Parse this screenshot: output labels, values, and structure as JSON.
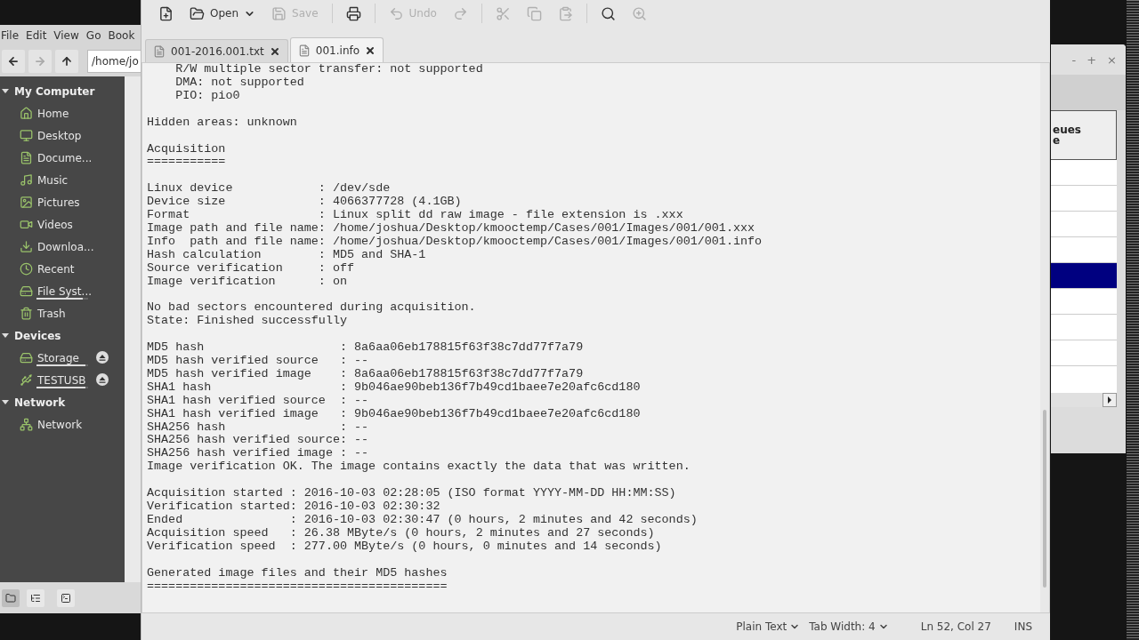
{
  "file_manager": {
    "menu": [
      "File",
      "Edit",
      "View",
      "Go",
      "Book"
    ],
    "nav": [
      {
        "kind": "back",
        "disabled": false
      },
      {
        "kind": "forward",
        "disabled": true
      },
      {
        "kind": "up",
        "disabled": false
      }
    ],
    "path": "/home/jo",
    "sections": [
      {
        "title": "My Computer",
        "expanded": true,
        "items": [
          {
            "label": "Home"
          },
          {
            "label": "Desktop"
          },
          {
            "label": "Docume..."
          },
          {
            "label": "Music"
          },
          {
            "label": "Pictures"
          },
          {
            "label": "Videos"
          },
          {
            "label": "Downloa..."
          },
          {
            "label": "Recent"
          },
          {
            "label": "File Syst...",
            "level": 0.9
          },
          {
            "label": "Trash"
          }
        ]
      },
      {
        "title": "Devices",
        "expanded": true,
        "items": [
          {
            "label": "Storage",
            "level": 0.95,
            "ejectable": true
          },
          {
            "label": "TESTUSB",
            "level": 0.95,
            "ejectable": true
          }
        ]
      },
      {
        "title": "Network",
        "expanded": true,
        "items": [
          {
            "label": "Network"
          }
        ]
      }
    ],
    "bottom_buttons": [
      {
        "kind": "places",
        "selected": true
      },
      {
        "kind": "tree",
        "selected": false
      },
      {
        "kind": "terminal",
        "selected": false
      }
    ]
  },
  "editor": {
    "toolbar": [
      {
        "kind": "new",
        "disabled": false
      },
      {
        "kind": "open",
        "label": "Open",
        "disabled": false
      },
      {
        "kind": "save",
        "label": "Save",
        "disabled": true
      },
      {
        "kind": "print",
        "disabled": false
      },
      {
        "kind": "undo",
        "label": "Undo",
        "disabled": true
      },
      {
        "kind": "redo",
        "disabled": true
      },
      {
        "kind": "cut",
        "disabled": true
      },
      {
        "kind": "copy",
        "disabled": true
      },
      {
        "kind": "paste",
        "disabled": true
      },
      {
        "kind": "find",
        "disabled": false
      },
      {
        "kind": "replace",
        "disabled": true
      }
    ],
    "tabs": [
      {
        "label": "001-2016.001.txt",
        "selected": false
      },
      {
        "label": "001.info",
        "selected": true
      }
    ],
    "blocks": [
      {
        "kind": "paragraph",
        "lines": [
          "    R/W multiple sector transfer: not supported",
          "    DMA: not supported",
          "    PIO: pio0"
        ]
      },
      {
        "kind": "paragraph",
        "lines": [
          "Hidden areas: unknown"
        ]
      },
      {
        "kind": "heading",
        "lines": [
          "Acquisition",
          "==========="
        ]
      },
      {
        "kind": "paragraph",
        "lines": [
          "Linux device            : /dev/sde",
          "Device size             : 4066377728 (4.1GB)",
          "Format                  : Linux split dd raw image - file extension is .xxx",
          "Image path and file name: /home/joshua/Desktop/kmooctemp/Cases/001/Images/001/001.xxx",
          "Info  path and file name: /home/joshua/Desktop/kmooctemp/Cases/001/Images/001/001.info",
          "Hash calculation        : MD5 and SHA-1",
          "Source verification     : off",
          "Image verification      : on"
        ]
      },
      {
        "kind": "paragraph",
        "lines": [
          "No bad sectors encountered during acquisition.",
          "State: Finished successfully"
        ]
      },
      {
        "kind": "paragraph",
        "lines": [
          "MD5 hash                   : 8a6aa06eb178815f63f38c7dd77f7a79",
          "MD5 hash verified source   : --",
          "MD5 hash verified image    : 8a6aa06eb178815f63f38c7dd77f7a79",
          "SHA1 hash                  : 9b046ae90beb136f7b49cd1baee7e20afc6cd180",
          "SHA1 hash verified source  : --",
          "SHA1 hash verified image   : 9b046ae90beb136f7b49cd1baee7e20afc6cd180",
          "SHA256 hash                : --",
          "SHA256 hash verified source: --",
          "SHA256 hash verified image : --",
          "Image verification OK. The image contains exactly the data that was written."
        ]
      },
      {
        "kind": "paragraph",
        "lines": [
          "Acquisition started : 2016-10-03 02:28:05 (ISO format YYYY-MM-DD HH:MM:SS)",
          "Verification started: 2016-10-03 02:30:32",
          "Ended               : 2016-10-03 02:30:47 (0 hours, 2 minutes and 42 seconds)",
          "Acquisition speed   : 26.38 MByte/s (0 hours, 2 minutes and 27 seconds)",
          "Verification speed  : 277.00 MByte/s (0 hours, 0 minutes and 14 seconds)"
        ]
      },
      {
        "kind": "heading",
        "lines": [
          "Generated image files and their MD5 hashes",
          "=========================================="
        ]
      }
    ],
    "status": {
      "syntax": "Plain Text",
      "tab_width": "Tab Width: 4",
      "position": "Ln 52, Col 27",
      "mode": "INS"
    }
  },
  "back_window": {
    "controls": [
      "-",
      "+",
      "×"
    ],
    "header_lines": [
      "eues",
      "e"
    ],
    "rows": [
      {
        "selected": false
      },
      {
        "selected": false
      },
      {
        "selected": false
      },
      {
        "selected": false
      },
      {
        "selected": true
      },
      {
        "selected": false
      },
      {
        "selected": false
      },
      {
        "selected": false
      }
    ]
  }
}
